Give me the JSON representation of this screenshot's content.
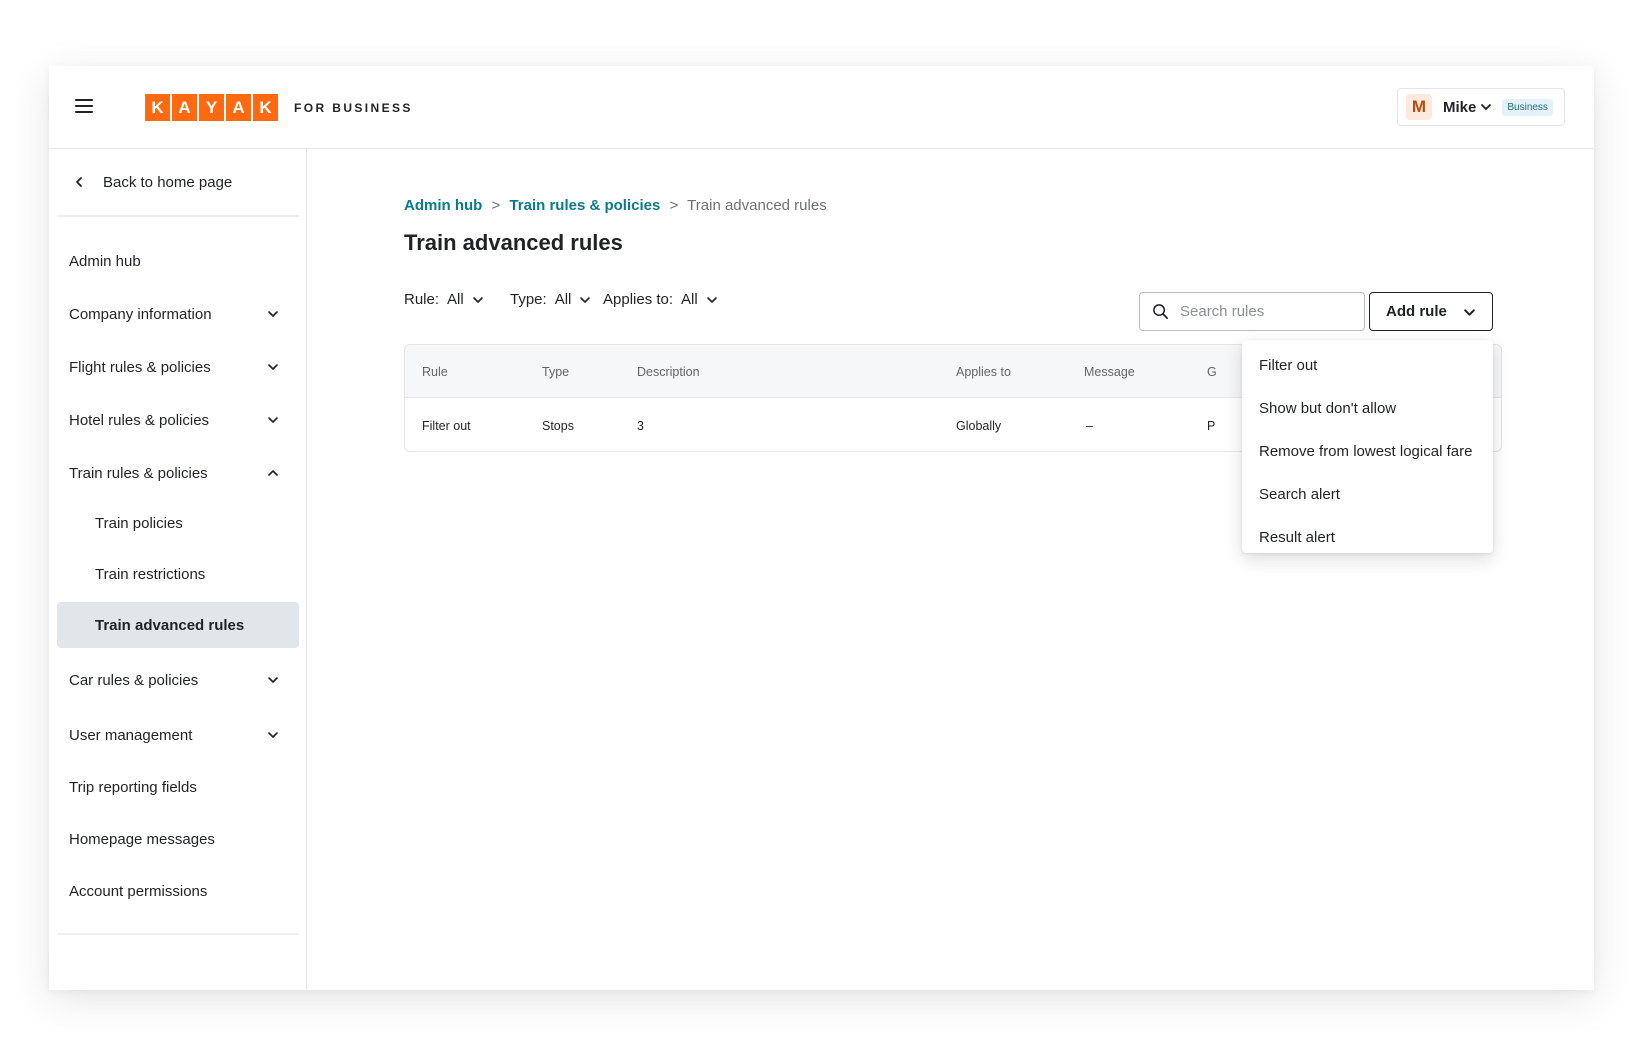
{
  "header": {
    "logo_letters": [
      "K",
      "A",
      "Y",
      "A",
      "K"
    ],
    "logo_suffix": "FOR BUSINESS",
    "user": {
      "initial": "M",
      "name": "Mike",
      "badge": "Business"
    }
  },
  "sidebar": {
    "back_label": "Back to home page",
    "items": [
      {
        "label": "Admin hub"
      },
      {
        "label": "Company information"
      },
      {
        "label": "Flight rules & policies"
      },
      {
        "label": "Hotel rules & policies"
      },
      {
        "label": "Train rules & policies"
      },
      {
        "label": "Train policies"
      },
      {
        "label": "Train restrictions"
      },
      {
        "label": "Train advanced rules"
      },
      {
        "label": "Car rules & policies"
      },
      {
        "label": "User management"
      },
      {
        "label": "Trip reporting fields"
      },
      {
        "label": "Homepage messages"
      },
      {
        "label": "Account permissions"
      }
    ]
  },
  "breadcrumb": {
    "items": [
      "Admin hub",
      "Train rules & policies",
      "Train advanced rules"
    ],
    "separator": ">"
  },
  "page_title": "Train advanced rules",
  "filters": [
    {
      "label": "Rule:",
      "value": "All"
    },
    {
      "label": "Type:",
      "value": "All"
    },
    {
      "label": "Applies to:",
      "value": "All"
    }
  ],
  "search": {
    "placeholder": "Search rules"
  },
  "add_rule": {
    "label": "Add rule",
    "menu": [
      "Filter out",
      "Show but don't allow",
      "Remove from lowest logical fare",
      "Search alert",
      "Result alert"
    ]
  },
  "table": {
    "columns": [
      "Rule",
      "Type",
      "Description",
      "Applies to",
      "Message",
      "G"
    ],
    "rows": [
      [
        "Filter out",
        "Stops",
        "3",
        "Globally",
        "–",
        "P"
      ]
    ]
  },
  "colors": {
    "brand": "#ff690f",
    "link": "#0b7a8b",
    "active_bg": "#e1e6ea"
  }
}
